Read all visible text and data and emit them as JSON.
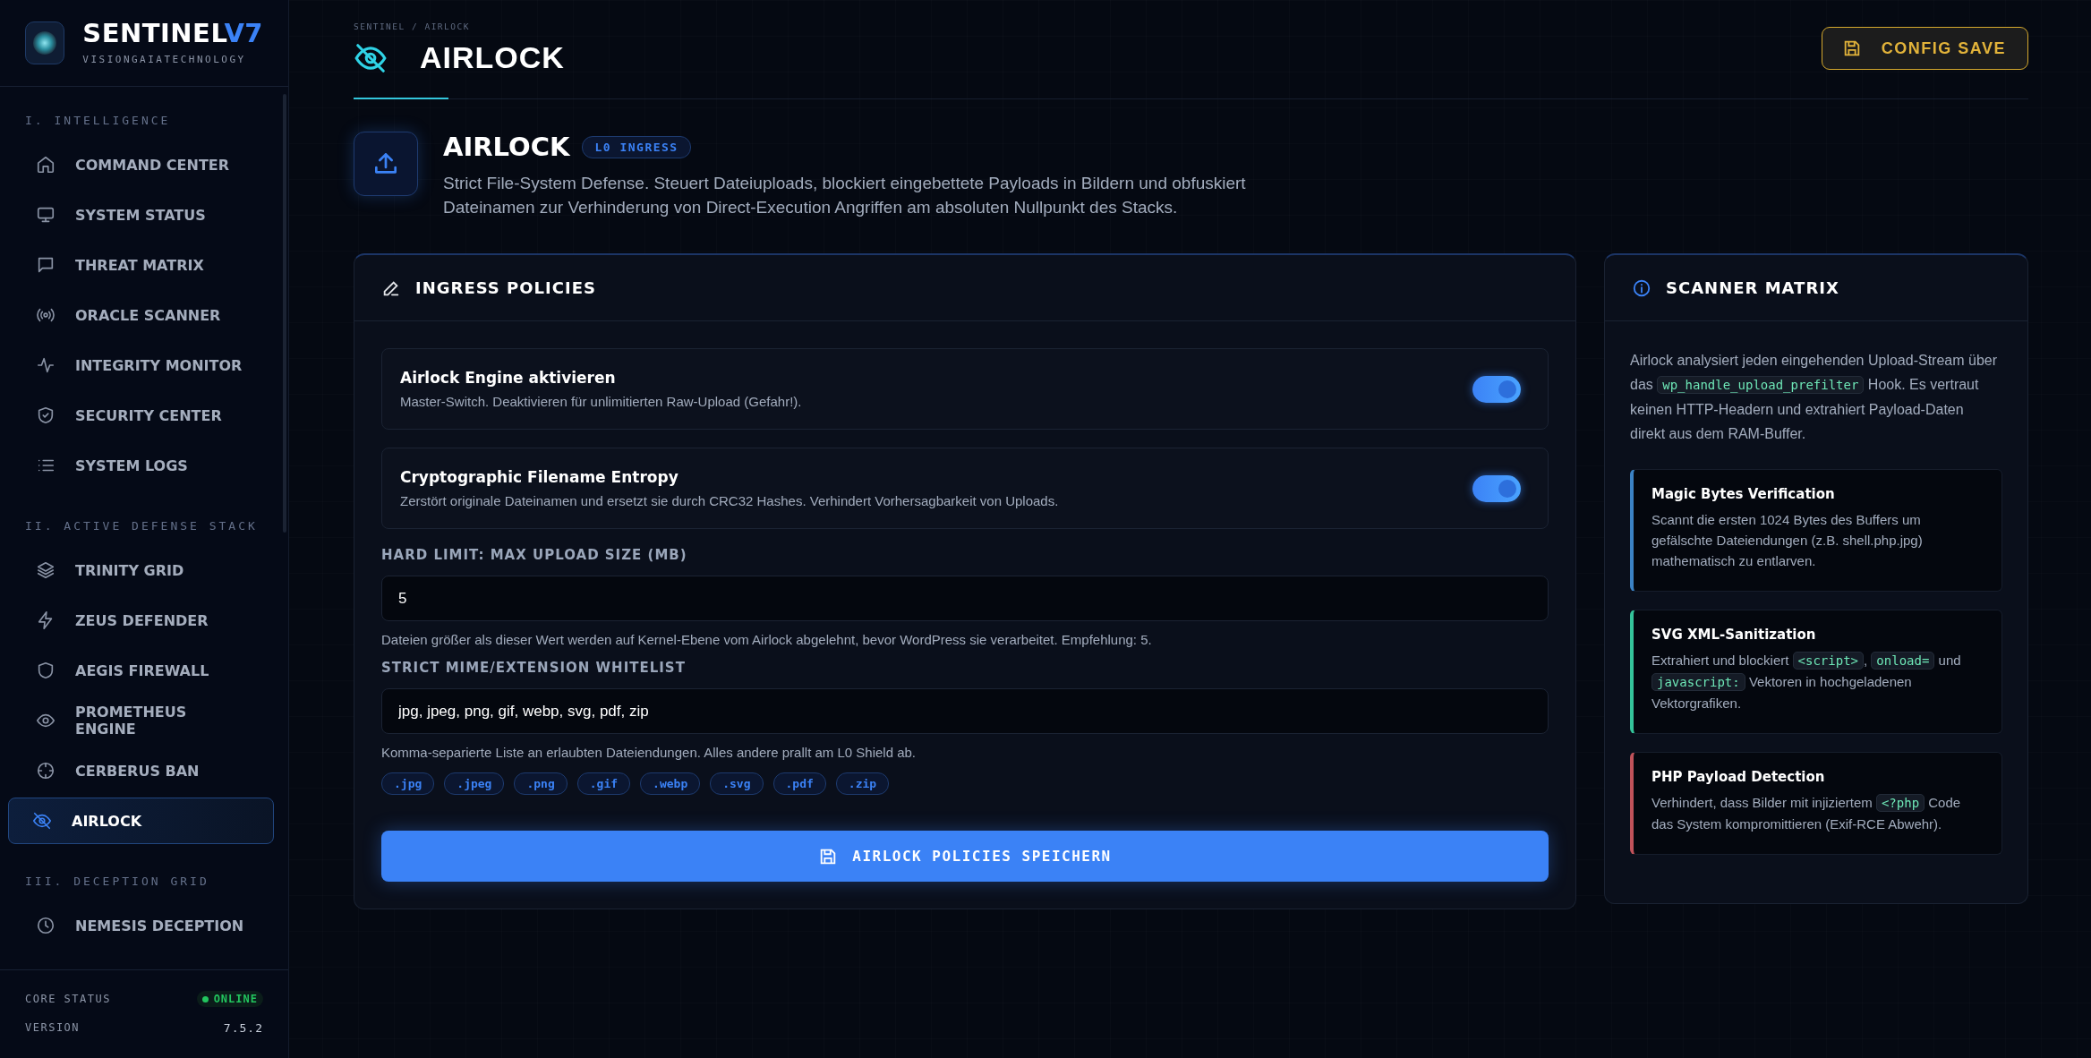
{
  "sidebar": {
    "brand": {
      "name": "SENTINEL",
      "version": "V7",
      "tagline": "VISIONGAIATECHNOLOGY"
    },
    "sections": [
      {
        "title": "I. INTELLIGENCE",
        "items": [
          {
            "label": "COMMAND CENTER",
            "kind": "home",
            "selected": false
          },
          {
            "label": "SYSTEM STATUS",
            "kind": "monitor",
            "selected": false
          },
          {
            "label": "THREAT MATRIX",
            "kind": "chat",
            "selected": false
          },
          {
            "label": "ORACLE SCANNER",
            "kind": "broadcast",
            "selected": false
          },
          {
            "label": "INTEGRITY MONITOR",
            "kind": "pulse",
            "selected": false
          },
          {
            "label": "SECURITY CENTER",
            "kind": "shieldcheck",
            "selected": false
          },
          {
            "label": "SYSTEM LOGS",
            "kind": "list",
            "selected": false
          }
        ]
      },
      {
        "title": "II. ACTIVE DEFENSE STACK",
        "items": [
          {
            "label": "TRINITY GRID",
            "kind": "layers",
            "selected": false
          },
          {
            "label": "ZEUS DEFENDER",
            "kind": "bolt",
            "selected": false
          },
          {
            "label": "AEGIS FIREWALL",
            "kind": "shield",
            "selected": false
          },
          {
            "label": "PROMETHEUS ENGINE",
            "kind": "eye",
            "selected": false
          },
          {
            "label": "CERBERUS BAN",
            "kind": "crosshair",
            "selected": false
          },
          {
            "label": "AIRLOCK",
            "kind": "eyeoff",
            "selected": true
          }
        ]
      },
      {
        "title": "III. DECEPTION GRID",
        "items": [
          {
            "label": "NEMESIS DECEPTION",
            "kind": "clock",
            "selected": false
          }
        ]
      }
    ],
    "footer": {
      "status_label": "CORE STATUS",
      "status": "ONLINE",
      "online": true,
      "version_label": "VERSION",
      "version": "7.5.2"
    }
  },
  "header": {
    "breadcrumb": "SENTINEL / AIRLOCK",
    "title": "AIRLOCK",
    "button": "CONFIG SAVE"
  },
  "module": {
    "title": "AIRLOCK",
    "badge": "L0 INGRESS",
    "description": "Strict File-System Defense. Steuert Dateiuploads, blockiert eingebettete Payloads in Bildern und obfuskiert Dateinamen zur Verhinderung von Direct-Execution Angriffen am absoluten Nullpunkt des Stacks."
  },
  "policies": {
    "title": "INGRESS POLICIES",
    "toggles": [
      {
        "label": "Airlock Engine aktivieren",
        "description": "Master-Switch. Deaktivieren für unlimitierten Raw-Upload (Gefahr!).",
        "on": true
      },
      {
        "label": "Cryptographic Filename Entropy",
        "description": "Zerstört originale Dateinamen und ersetzt sie durch CRC32 Hashes. Verhindert Vorhersagbarkeit von Uploads.",
        "on": true
      }
    ],
    "fields": [
      {
        "label": "HARD LIMIT: MAX UPLOAD SIZE (MB)",
        "value": "5",
        "hint": "Dateien größer als dieser Wert werden auf Kernel-Ebene vom Airlock abgelehnt, bevor WordPress sie verarbeitet. Empfehlung: 5."
      },
      {
        "label": "STRICT MIME/EXTENSION WHITELIST",
        "value": "jpg, jpeg, png, gif, webp, svg, pdf, zip",
        "hint": "Komma-separierte Liste an erlaubten Dateiendungen. Alles andere prallt am L0 Shield ab."
      }
    ],
    "tags": [
      ".jpg",
      ".jpeg",
      ".png",
      ".gif",
      ".webp",
      ".svg",
      ".pdf",
      ".zip"
    ],
    "save_button": "AIRLOCK POLICIES SPEICHERN"
  },
  "scanner": {
    "title": "SCANNER MATRIX",
    "intro": [
      {
        "kind": "text",
        "text": "Airlock analysiert jeden eingehenden Upload-Stream über das "
      },
      {
        "kind": "code",
        "text": "wp_handle_upload_prefilter"
      },
      {
        "kind": "text",
        "text": " Hook. Es vertraut keinen HTTP-Headern und extrahiert Payload-Daten direkt aus dem RAM-Buffer."
      }
    ],
    "cards": [
      {
        "title": "Magic Bytes Verification",
        "color": "#3b82c4",
        "parts": [
          {
            "kind": "text",
            "text": "Scannt die ersten 1024 Bytes des Buffers um gefälschte Dateiendungen (z.B. shell.php.jpg) mathematisch zu entlarven."
          }
        ]
      },
      {
        "title": "SVG XML-Sanitization",
        "color": "#34c39a",
        "parts": [
          {
            "kind": "text",
            "text": "Extrahiert und blockiert "
          },
          {
            "kind": "code",
            "text": "<script>"
          },
          {
            "kind": "text",
            "text": ", "
          },
          {
            "kind": "code",
            "text": "onload="
          },
          {
            "kind": "text",
            "text": " und "
          },
          {
            "kind": "code",
            "text": "javascript:"
          },
          {
            "kind": "text",
            "text": " Vektoren in hochgeladenen Vektorgrafiken."
          }
        ]
      },
      {
        "title": "PHP Payload Detection",
        "color": "#c0525a",
        "parts": [
          {
            "kind": "text",
            "text": "Verhindert, dass Bilder mit injiziertem "
          },
          {
            "kind": "code",
            "text": "<?php"
          },
          {
            "kind": "text",
            "text": " Code das System kompromittieren (Exif-RCE Abwehr)."
          }
        ]
      }
    ]
  }
}
